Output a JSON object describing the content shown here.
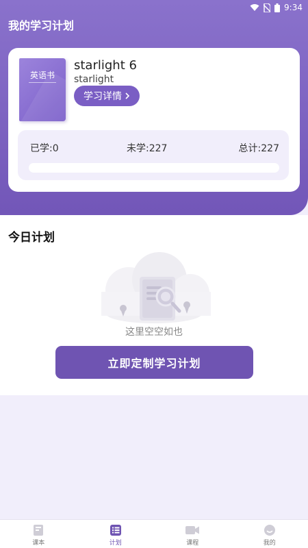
{
  "status": {
    "time": "9:34"
  },
  "header": {
    "title": "我的学习计划"
  },
  "book": {
    "cover_title": "英语书",
    "name": "starlight 6",
    "subtitle": "starlight",
    "detail_label": "学习详情",
    "stats": {
      "learned": "已学:0",
      "unlearned": "未学:227",
      "total": "总计:227"
    },
    "progress": 0
  },
  "today": {
    "title": "今日计划",
    "empty_text": "这里空空如也",
    "create_label": "立即定制学习计划"
  },
  "nav": {
    "items": [
      {
        "label": "课本",
        "icon": "book-icon"
      },
      {
        "label": "计划",
        "icon": "plan-list-icon"
      },
      {
        "label": "课程",
        "icon": "video-camera-icon"
      },
      {
        "label": "我的",
        "icon": "profile-icon"
      }
    ],
    "active": "计划"
  },
  "colors": {
    "accent": "#6f54b2",
    "header": "#7e64c2",
    "background": "#f1eefb"
  }
}
